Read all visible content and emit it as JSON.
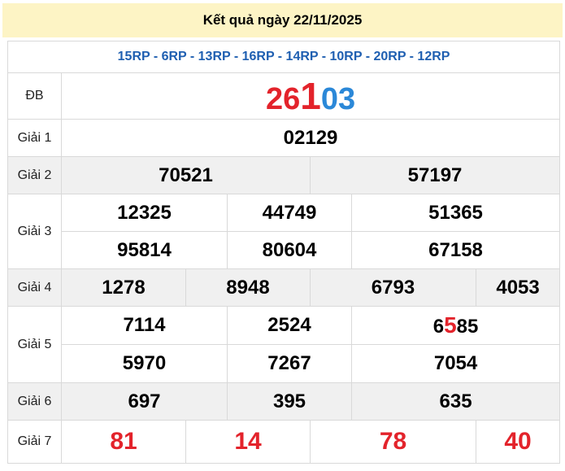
{
  "title": "Kết quả ngày 22/11/2025",
  "codes": "15RP - 6RP - 13RP - 16RP - 14RP - 10RP - 20RP - 12RP",
  "special": {
    "label": "ĐB",
    "part_red": "26",
    "part_big": "1",
    "part_blue": "03"
  },
  "prize1": {
    "label": "Giải 1",
    "values": [
      "02129"
    ]
  },
  "prize2": {
    "label": "Giải 2",
    "values": [
      "70521",
      "57197"
    ]
  },
  "prize3": {
    "label": "Giải 3",
    "values": [
      "12325",
      "44749",
      "51365",
      "95814",
      "80604",
      "67158"
    ]
  },
  "prize4": {
    "label": "Giải 4",
    "values": [
      "1278",
      "8948",
      "6793",
      "4053"
    ]
  },
  "prize5": {
    "label": "Giải 5",
    "values": [
      "7114",
      "2524",
      "6585",
      "5970",
      "7267",
      "7054"
    ],
    "highlight_a": "6",
    "highlight_b": "5",
    "highlight_c": "85"
  },
  "prize6": {
    "label": "Giải 6",
    "values": [
      "697",
      "395",
      "635"
    ]
  },
  "prize7": {
    "label": "Giải 7",
    "values": [
      "81",
      "14",
      "78",
      "40"
    ]
  },
  "colors": {
    "red": "#e3232b",
    "blue": "#2b88d8",
    "code_blue": "#1f5fb1",
    "title_bg": "#fdf4c5",
    "row_gray": "#f0f0f0"
  }
}
